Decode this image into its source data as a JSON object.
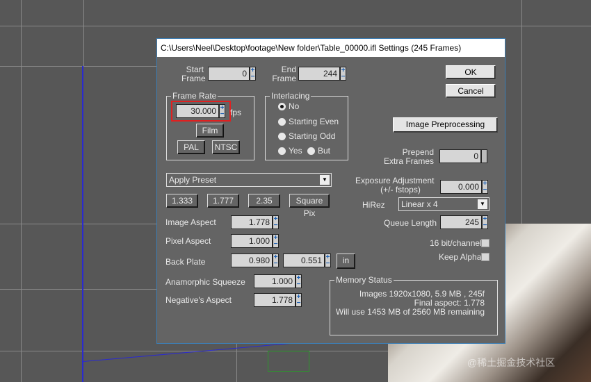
{
  "dialog": {
    "title": "C:\\Users\\Neel\\Desktop\\footage\\New folder\\Table_00000.ifl Settings (245 Frames)",
    "start_frame": {
      "label1": "Start",
      "label2": "Frame",
      "value": "0"
    },
    "end_frame": {
      "label1": "End",
      "label2": "Frame",
      "value": "244"
    },
    "ok": "OK",
    "cancel": "Cancel",
    "frame_rate": {
      "title": "Frame Rate",
      "value": "30.000",
      "unit": "fps",
      "film": "Film",
      "pal": "PAL",
      "ntsc": "NTSC"
    },
    "interlacing": {
      "title": "Interlacing",
      "options": [
        "No",
        "Starting Even",
        "Starting Odd",
        "Yes",
        "But"
      ],
      "selected": "No"
    },
    "image_preprocessing": "Image Preprocessing",
    "prepend": {
      "label1": "Prepend",
      "label2": "Extra Frames",
      "value": "0"
    },
    "preset": {
      "value": "Apply Preset",
      "buttons": [
        "1.333",
        "1.777",
        "2.35",
        "Square Pix"
      ]
    },
    "exposure": {
      "label1": "Exposure Adjustment",
      "label2": "(+/- fstops)",
      "value": "0.000"
    },
    "hirez": {
      "label": "HiRez",
      "value": "Linear x 4"
    },
    "queue_length": {
      "label": "Queue Length",
      "value": "245"
    },
    "bit16": {
      "label": "16 bit/channel",
      "checked": false
    },
    "keep_alpha": {
      "label": "Keep Alpha",
      "checked": false
    },
    "image_aspect": {
      "label": "Image Aspect",
      "value": "1.778"
    },
    "pixel_aspect": {
      "label": "Pixel Aspect",
      "value": "1.000"
    },
    "back_plate": {
      "label": "Back Plate",
      "value1": "0.980",
      "value2": "0.551",
      "unit_button": "in"
    },
    "anamorphic": {
      "label": "Anamorphic Squeeze",
      "value": "1.000"
    },
    "negative_aspect": {
      "label": "Negative's Aspect",
      "value": "1.778"
    },
    "memory": {
      "title": "Memory Status",
      "line1": "Images 1920x1080, 5.9 MB , 245f",
      "line2": "Final aspect: 1.778",
      "line3": "Will use 1453 MB of 2560 MB remaining"
    }
  },
  "watermark": "@稀土掘金技术社区",
  "colors": {
    "highlight": "#e02020",
    "spinner": "#1a5fb4"
  }
}
